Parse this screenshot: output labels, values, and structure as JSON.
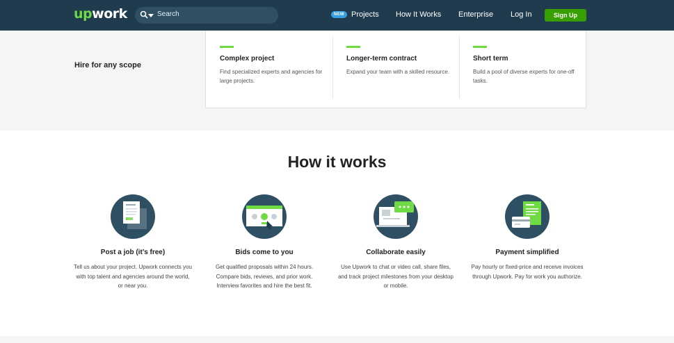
{
  "nav": {
    "logo": "upwork",
    "search_placeholder": "Search",
    "new_badge": "NEW",
    "items": [
      "Projects",
      "How It Works",
      "Enterprise",
      "Log In"
    ],
    "signup": "Sign Up"
  },
  "scope": {
    "title": "Hire for any scope",
    "columns": [
      {
        "heading": "Complex project",
        "text": "Find specialized experts and agencies for large projects."
      },
      {
        "heading": "Longer-term contract",
        "text": "Expand your team with a skilled resource."
      },
      {
        "heading": "Short term",
        "text": "Build a pool of diverse experts for one-off tasks."
      }
    ]
  },
  "how": {
    "title": "How it works",
    "steps": [
      {
        "heading": "Post a job (it’s free)",
        "text": "Tell us about your project. Upwork connects you with top talent and agencies around the world, or near you.",
        "icon": "job-post-icon"
      },
      {
        "heading": "Bids come to you",
        "text": "Get qualified proposals within 24 hours. Compare bids, reviews, and prior work. Interview favorites and hire the best fit.",
        "icon": "bids-icon"
      },
      {
        "heading": "Collaborate easily",
        "text": "Use Upwork to chat or video call, share files, and track project milestones from your desktop or mobile.",
        "icon": "collaborate-icon"
      },
      {
        "heading": "Payment simplified",
        "text": "Pay hourly or fixed-price and receive invoices through Upwork. Pay for work you authorize.",
        "icon": "payment-icon"
      }
    ]
  },
  "colors": {
    "nav_bg": "#1f3b4d",
    "brand_green": "#6fda44",
    "signup_green": "#37a000",
    "icon_bg": "#2f4f63"
  }
}
